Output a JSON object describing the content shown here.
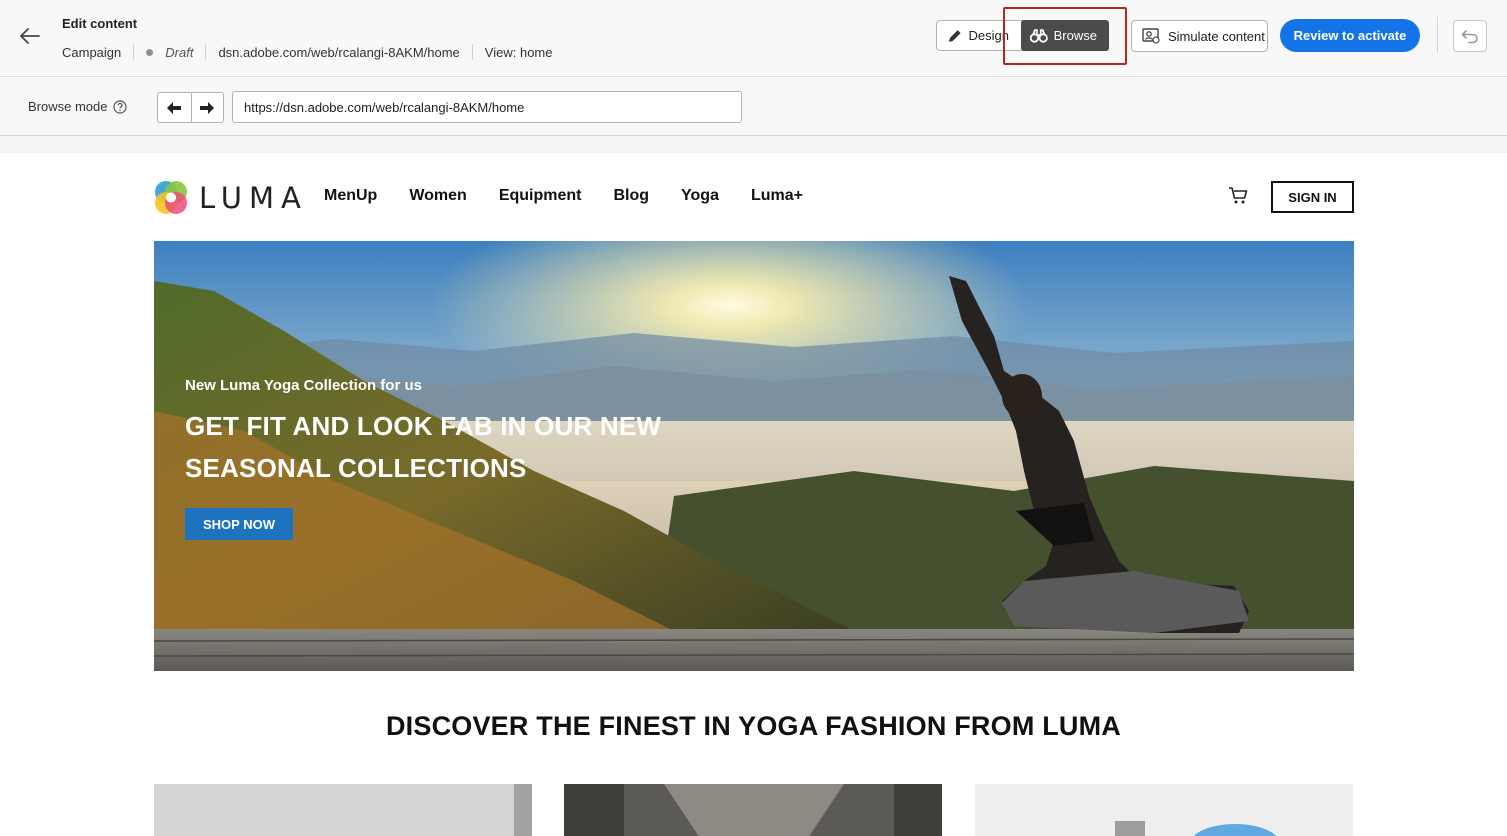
{
  "header": {
    "title": "Edit content",
    "type": "Campaign",
    "status": "Draft",
    "url": "dsn.adobe.com/web/rcalangi-8AKM/home",
    "view": "View: home",
    "mode_design": "Design",
    "mode_browse": "Browse",
    "simulate_label": "Simulate content",
    "review_label": "Review to activate"
  },
  "browse_bar": {
    "label": "Browse mode",
    "url_value": "https://dsn.adobe.com/web/rcalangi-8AKM/home"
  },
  "site": {
    "brand": "LUMA",
    "nav": [
      "MenUp",
      "Women",
      "Equipment",
      "Blog",
      "Yoga",
      "Luma+"
    ],
    "signin": "SIGN IN",
    "hero": {
      "kicker": "New Luma Yoga Collection for us",
      "title_line1": "GET FIT AND LOOK FAB IN OUR NEW",
      "title_line2": "SEASONAL COLLECTIONS",
      "cta": "SHOP NOW"
    },
    "section_title": "DISCOVER THE FINEST IN YOGA FASHION FROM LUMA"
  },
  "colors": {
    "accent": "#1473e6",
    "highlight": "#b3271f",
    "shop_button": "#1e73be"
  }
}
